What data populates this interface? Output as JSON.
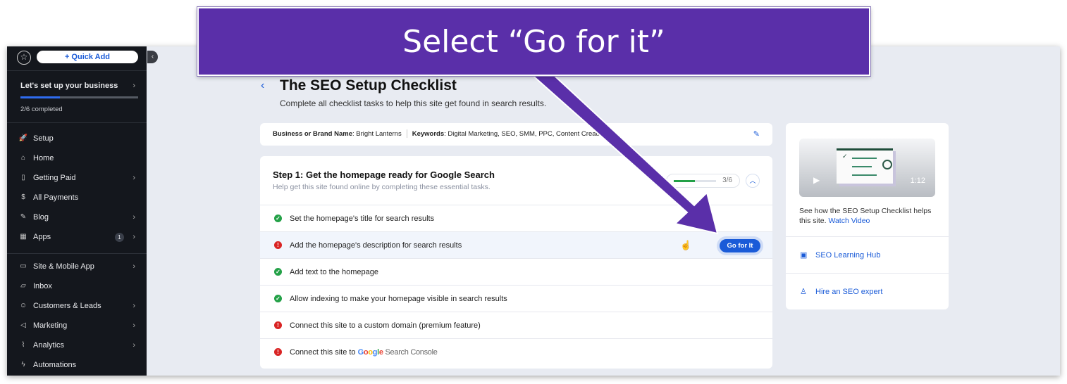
{
  "callout": {
    "text": "Select “Go for it”",
    "color": "#5a2fa9"
  },
  "sidebar": {
    "quick_add": "+ Quick Add",
    "setup_title": "Let's set up your business",
    "progress_fraction": 0.333,
    "completed": "2/6 completed",
    "items": [
      {
        "label": "Setup",
        "icon": "rocket-icon",
        "glyph": "🚀"
      },
      {
        "label": "Home",
        "icon": "home-icon",
        "glyph": "⌂"
      },
      {
        "label": "Getting Paid",
        "icon": "invoice-icon",
        "glyph": "▯",
        "chev": true
      },
      {
        "label": "All Payments",
        "icon": "dollar-icon",
        "glyph": "$"
      },
      {
        "label": "Blog",
        "icon": "pen-nib-icon",
        "glyph": "✎",
        "chev": true
      },
      {
        "label": "Apps",
        "icon": "apps-icon",
        "glyph": "▦",
        "badge": "1",
        "chev": true
      },
      {
        "label": "Site & Mobile App",
        "icon": "devices-icon",
        "glyph": "▭",
        "chev": true
      },
      {
        "label": "Inbox",
        "icon": "inbox-icon",
        "glyph": "▱"
      },
      {
        "label": "Customers & Leads",
        "icon": "people-icon",
        "glyph": "☺",
        "chev": true
      },
      {
        "label": "Marketing",
        "icon": "megaphone-icon",
        "glyph": "◁",
        "chev": true
      },
      {
        "label": "Analytics",
        "icon": "chart-icon",
        "glyph": "⌇",
        "chev": true
      },
      {
        "label": "Automations",
        "icon": "bolt-icon",
        "glyph": "ϟ"
      }
    ]
  },
  "page": {
    "title": "The SEO Setup Checklist",
    "subtitle": "Complete all checklist tasks to help this site get found in search results."
  },
  "info": {
    "brand_label": "Business or Brand Name",
    "brand_value": ": Bright Lanterns",
    "kw_label": "Keywords",
    "kw_value": ": Digital Marketing, SEO, SMM, PPC, Content Creation"
  },
  "step": {
    "title": "Step 1: Get the homepage ready for Google Search",
    "desc": "Help get this site found online by completing these essential tasks.",
    "progress": "3/6",
    "progress_fraction": 0.5,
    "tasks": [
      {
        "label": "Set the homepage's title for search results",
        "status": "done"
      },
      {
        "label": "Add the homepage's description for search results",
        "status": "todo",
        "button": "Go for It"
      },
      {
        "label": "Add text to the homepage",
        "status": "done"
      },
      {
        "label": "Allow indexing to make your homepage visible in search results",
        "status": "done"
      },
      {
        "label": "Connect this site to a custom domain (premium feature)",
        "status": "todo"
      },
      {
        "label": "Connect this site to",
        "status": "todo",
        "logo": "Google Search Console"
      }
    ]
  },
  "aside": {
    "duration": "1:12",
    "video_text": "See how the SEO Setup Checklist helps this site.",
    "watch": "Watch Video",
    "hub": "SEO Learning Hub",
    "expert": "Hire an SEO expert"
  }
}
